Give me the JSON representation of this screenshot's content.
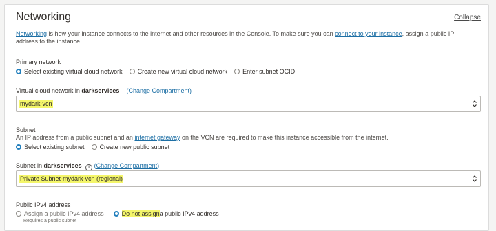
{
  "section": {
    "title": "Networking",
    "collapse_label": "Collapse"
  },
  "intro": {
    "link1": "Networking",
    "text1": " is how your instance connects to the internet and other resources in the Console. To make sure you can ",
    "link2": "connect to your instance",
    "text2": ", assign a public IP address to the instance."
  },
  "primary_network": {
    "label": "Primary network",
    "options": [
      {
        "label": "Select existing virtual cloud network",
        "selected": true
      },
      {
        "label": "Create new virtual cloud network",
        "selected": false
      },
      {
        "label": "Enter subnet OCID",
        "selected": false
      }
    ]
  },
  "vcn": {
    "label_prefix": "Virtual cloud network in ",
    "compartment": "darkservices",
    "change_compartment": "Change Compartment",
    "open_paren": "(",
    "close_paren": ")",
    "value": "mydark-vcn"
  },
  "subnet": {
    "label": "Subnet",
    "desc1": "An IP address from a public subnet and an ",
    "desc_link": "internet gateway",
    "desc2": " on the VCN are required to make this instance accessible from the internet.",
    "options": [
      {
        "label": "Select existing subnet",
        "selected": true
      },
      {
        "label": "Create new public subnet",
        "selected": false
      }
    ],
    "in_label_prefix": "Subnet in ",
    "compartment": "darkservices",
    "change_compartment": "Change Compartment",
    "open_paren": "(",
    "close_paren": ")",
    "value": "Private Subnet-mydark-vcn (regional)"
  },
  "public_ip": {
    "label": "Public IPv4 address",
    "options": [
      {
        "label": "Assign a public IPv4 address",
        "selected": false,
        "help": "Requires a public subnet"
      },
      {
        "label_highlight": "Do not assign ",
        "label_rest": "a public IPv4 address",
        "selected": true
      }
    ]
  },
  "colors": {
    "accent": "#227fbd",
    "link": "#1d6fa5",
    "highlight": "#f4f66a"
  }
}
